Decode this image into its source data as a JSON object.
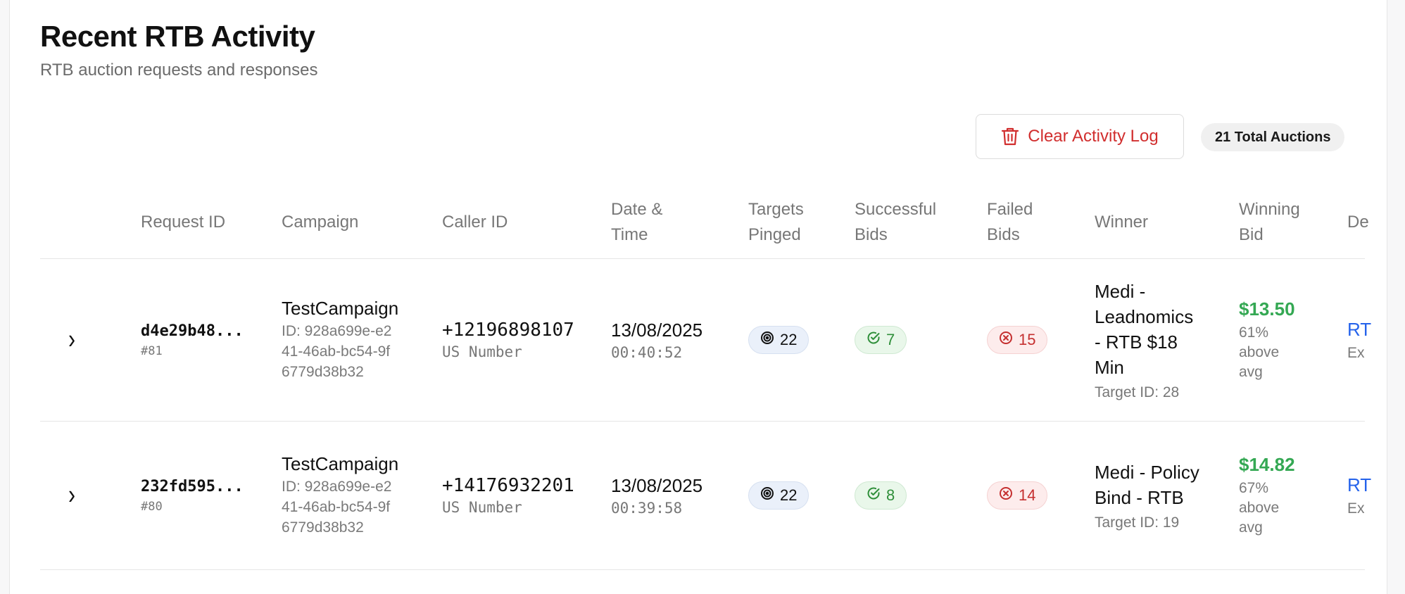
{
  "header": {
    "title": "Recent RTB Activity",
    "subtitle": "RTB auction requests and responses"
  },
  "toolbar": {
    "clear_label": "Clear Activity Log",
    "total_label": "21 Total Auctions"
  },
  "columns": {
    "request_id": "Request ID",
    "campaign": "Campaign",
    "caller_id": "Caller ID",
    "date_time": "Date & Time",
    "targets_pinged": "Targets Pinged",
    "successful_bids": "Successful Bids",
    "failed_bids": "Failed Bids",
    "winner": "Winner",
    "winning_bid": "Winning Bid",
    "details": "De"
  },
  "rows": [
    {
      "request_id": "d4e29b48...",
      "request_num": "#81",
      "campaign_name": "TestCampaign",
      "campaign_id": "ID: 928a699e-e241-46ab-bc54-9f6779d38b32",
      "caller_number": "+12196898107",
      "caller_type": "US Number",
      "date": "13/08/2025",
      "time": "00:40:52",
      "targets_pinged": "22",
      "successful_bids": "7",
      "failed_bids": "15",
      "winner_name": "Medi - Leadnomics - RTB $18 Min",
      "winner_target": "Target ID: 28",
      "winning_bid": "$13.50",
      "bid_note": "61% above avg",
      "details_link": "RT",
      "details_sub": "Ex"
    },
    {
      "request_id": "232fd595...",
      "request_num": "#80",
      "campaign_name": "TestCampaign",
      "campaign_id": "ID: 928a699e-e241-46ab-bc54-9f6779d38b32",
      "caller_number": "+14176932201",
      "caller_type": "US Number",
      "date": "13/08/2025",
      "time": "00:39:58",
      "targets_pinged": "22",
      "successful_bids": "8",
      "failed_bids": "14",
      "winner_name": "Medi - Policy Bind - RTB",
      "winner_target": "Target ID: 19",
      "winning_bid": "$14.82",
      "bid_note": "67% above avg",
      "details_link": "RT",
      "details_sub": "Ex"
    }
  ],
  "icons": {
    "trash": "trash-icon",
    "chevron": "chevron-right-icon",
    "target": "target-icon",
    "check": "check-circle-icon",
    "x": "x-circle-icon"
  },
  "colors": {
    "danger": "#d12e2e",
    "success": "#34a853",
    "link": "#2563eb",
    "muted": "#777777"
  }
}
